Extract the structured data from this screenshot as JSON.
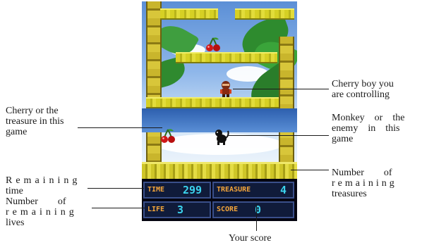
{
  "hud": {
    "time_label": "TIME",
    "time_value": "299",
    "treasure_label": "TREASURE",
    "treasure_value": "4",
    "life_label": "LIFE",
    "life_value": "3",
    "score_label": "SCORE",
    "score_value": "0"
  },
  "annotations": {
    "cherry_boy": [
      "Cherry boy you",
      "are controlling"
    ],
    "monkey": [
      "Monkey    or    the",
      "enemy    in    this",
      "game"
    ],
    "number_treasures": [
      "Number        of",
      "remaining",
      "treasures"
    ],
    "cherry_treasure": [
      "Cherry or the",
      "treasure in this",
      "game"
    ],
    "remaining_time": [
      "Remaining",
      "time"
    ],
    "number_lives": [
      "Number        of",
      "remaining",
      "lives"
    ],
    "your_score": "Your score"
  },
  "colors": {
    "hud_label": "#f4a53a",
    "hud_value": "#3cd4ee",
    "platform": "#d6d024"
  }
}
